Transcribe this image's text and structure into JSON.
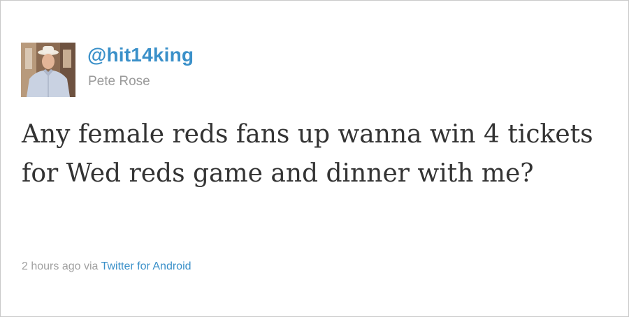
{
  "tweet": {
    "handle": "@hit14king",
    "name": "Pete Rose",
    "text": "Any female reds fans up wanna win 4 tickets for Wed reds game and dinner with me?",
    "time": "2 hours ago",
    "via": "via",
    "source": "Twitter for Android"
  },
  "colors": {
    "link": "#3a90c9",
    "muted": "#a0a0a0",
    "text": "#333333"
  },
  "icons": {
    "avatar": "profile-photo"
  }
}
